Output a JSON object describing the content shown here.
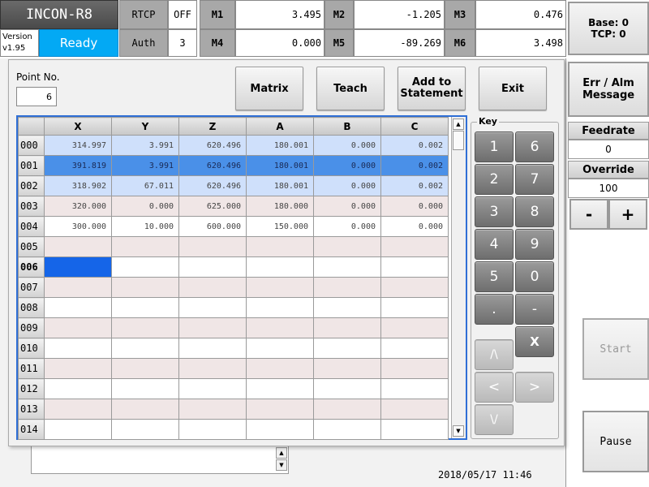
{
  "app_title": "INCON-R8",
  "version": {
    "label": "Version",
    "value": "v1.95"
  },
  "status": "Ready",
  "header_cells": [
    {
      "label": "RTCP",
      "value": "OFF"
    },
    {
      "label": "Auth",
      "value": "3"
    }
  ],
  "motors_row1": [
    {
      "label": "M1",
      "value": "3.495"
    },
    {
      "label": "M2",
      "value": "-1.205"
    },
    {
      "label": "M3",
      "value": "0.476"
    }
  ],
  "motors_row2": [
    {
      "label": "M4",
      "value": "0.000"
    },
    {
      "label": "M5",
      "value": "-89.269"
    },
    {
      "label": "M6",
      "value": "3.498"
    }
  ],
  "base_tcp": {
    "base": "Base: 0",
    "tcp": "TCP: 0"
  },
  "point_no": {
    "label": "Point No.",
    "value": "6"
  },
  "toolbar": {
    "matrix": "Matrix",
    "teach": "Teach",
    "add_to_statement": "Add to Statement",
    "exit": "Exit"
  },
  "table": {
    "columns": [
      "X",
      "Y",
      "Z",
      "A",
      "B",
      "C"
    ],
    "rows": [
      {
        "id": "000",
        "values": [
          "314.997",
          "3.991",
          "620.496",
          "180.001",
          "0.000",
          "0.002"
        ]
      },
      {
        "id": "001",
        "values": [
          "391.819",
          "3.991",
          "620.496",
          "180.001",
          "0.000",
          "0.002"
        ]
      },
      {
        "id": "002",
        "values": [
          "318.902",
          "67.011",
          "620.496",
          "180.001",
          "0.000",
          "0.002"
        ]
      },
      {
        "id": "003",
        "values": [
          "320.000",
          "0.000",
          "625.000",
          "180.000",
          "0.000",
          "0.000"
        ]
      },
      {
        "id": "004",
        "values": [
          "300.000",
          "10.000",
          "600.000",
          "150.000",
          "0.000",
          "0.000"
        ]
      },
      {
        "id": "005",
        "values": [
          "",
          "",
          "",
          "",
          "",
          ""
        ]
      },
      {
        "id": "006",
        "values": [
          "",
          "",
          "",
          "",
          "",
          ""
        ]
      },
      {
        "id": "007",
        "values": [
          "",
          "",
          "",
          "",
          "",
          ""
        ]
      },
      {
        "id": "008",
        "values": [
          "",
          "",
          "",
          "",
          "",
          ""
        ]
      },
      {
        "id": "009",
        "values": [
          "",
          "",
          "",
          "",
          "",
          ""
        ]
      },
      {
        "id": "010",
        "values": [
          "",
          "",
          "",
          "",
          "",
          ""
        ]
      },
      {
        "id": "011",
        "values": [
          "",
          "",
          "",
          "",
          "",
          ""
        ]
      },
      {
        "id": "012",
        "values": [
          "",
          "",
          "",
          "",
          "",
          ""
        ]
      },
      {
        "id": "013",
        "values": [
          "",
          "",
          "",
          "",
          "",
          ""
        ]
      },
      {
        "id": "014",
        "values": [
          "",
          "",
          "",
          "",
          "",
          ""
        ]
      }
    ]
  },
  "keypad": {
    "title": "Key",
    "keys": [
      "1",
      "6",
      "2",
      "7",
      "3",
      "8",
      "4",
      "9",
      "5",
      "0",
      ".",
      "-"
    ],
    "clear": "X",
    "up": "/\\",
    "left": "<",
    "right": ">",
    "down": "\\/"
  },
  "side": {
    "err_alm": "Err / Alm Message",
    "feedrate_label": "Feedrate",
    "feedrate_value": "0",
    "override_label": "Override",
    "override_value": "100",
    "minus": "-",
    "plus": "+",
    "start": "Start",
    "pause": "Pause"
  },
  "datetime": "2018/05/17 11:46",
  "colors": {
    "status_bg": "#03a9f4",
    "title_bg": "#5a5a5a",
    "selected_row": "#4a90e8",
    "active_cell": "#1565e8",
    "table_border": "#2f6fd6"
  }
}
